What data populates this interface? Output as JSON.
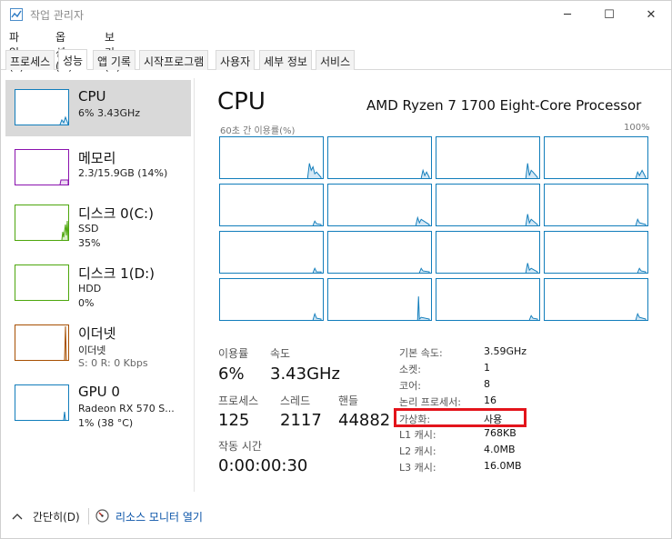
{
  "window": {
    "title": "작업 관리자",
    "controls": {
      "minimize": "─",
      "maximize": "☐",
      "close": "✕"
    }
  },
  "menu": [
    "파일(F)",
    "옵션(O)",
    "보기(V)"
  ],
  "tabs": [
    "프로세스",
    "성능",
    "앱 기록",
    "시작프로그램",
    "사용자",
    "세부 정보",
    "서비스"
  ],
  "active_tab": "성능",
  "sidebar": {
    "items": [
      {
        "title": "CPU",
        "sub1": "6% 3.43GHz",
        "sub2": "",
        "color": "#117dbb"
      },
      {
        "title": "메모리",
        "sub1": "2.3/15.9GB (14%)",
        "sub2": "",
        "color": "#8b12ae"
      },
      {
        "title": "디스크 0(C:)",
        "sub1": "SSD",
        "sub2": "35%",
        "color": "#4da60c"
      },
      {
        "title": "디스크 1(D:)",
        "sub1": "HDD",
        "sub2": "0%",
        "color": "#4da60c"
      },
      {
        "title": "이더넷",
        "sub1": "이더넷",
        "sub2": "S: 0  R: 0 Kbps",
        "color": "#a74f01"
      },
      {
        "title": "GPU 0",
        "sub1": "Radeon RX 570 S...",
        "sub2": "1% (38 °C)",
        "color": "#117dbb"
      }
    ]
  },
  "main": {
    "title": "CPU",
    "model": "AMD Ryzen 7 1700 Eight-Core Processor",
    "graph_label_left": "60초 간 이용률(%)",
    "graph_label_right": "100%",
    "stats": {
      "util_label": "이용률",
      "util_value": "6%",
      "speed_label": "속도",
      "speed_value": "3.43GHz",
      "proc_label": "프로세스",
      "proc_value": "125",
      "thread_label": "스레드",
      "thread_value": "2117",
      "handle_label": "핸들",
      "handle_value": "44882",
      "uptime_label": "작동 시간",
      "uptime_value": "0:00:00:30"
    },
    "details": [
      {
        "label": "기본 속도:",
        "value": "3.59GHz"
      },
      {
        "label": "소켓:",
        "value": "1"
      },
      {
        "label": "코어:",
        "value": "8"
      },
      {
        "label": "논리 프로세서:",
        "value": "16"
      },
      {
        "label": "가상화:",
        "value": "사용"
      },
      {
        "label": "L1 캐시:",
        "value": "768KB"
      },
      {
        "label": "L2 캐시:",
        "value": "4.0MB"
      },
      {
        "label": "L3 캐시:",
        "value": "16.0MB"
      }
    ]
  },
  "footer": {
    "collapse_label": "간단히(D)",
    "resource_monitor_label": "리소스 모니터 열기"
  }
}
